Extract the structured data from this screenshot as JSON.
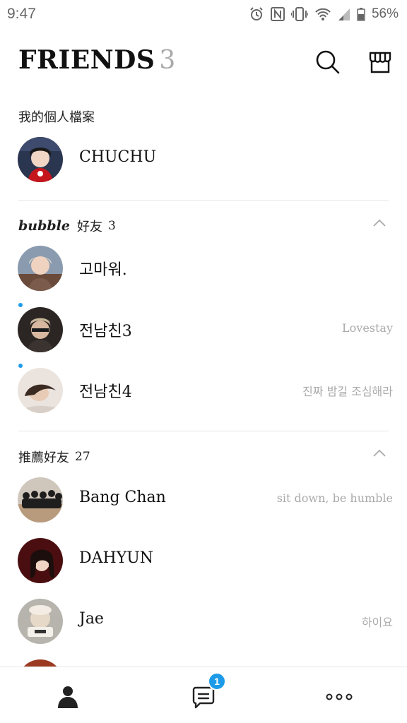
{
  "status_bar": {
    "time": "9:47",
    "battery": "56%",
    "icons": [
      "alarm-icon",
      "nfc-icon",
      "vibrate-icon",
      "wifi-icon",
      "signal-icon",
      "battery-icon"
    ]
  },
  "header": {
    "title": "FRIENDS",
    "count": "3",
    "search_icon": "search-icon",
    "shop_icon": "shop-icon"
  },
  "my_profile": {
    "label": "我的個人檔案",
    "name": "CHUCHU"
  },
  "bubble_section": {
    "bubble_word": "bubble",
    "label": "好友",
    "count": "3",
    "items": [
      {
        "name": "고마워.",
        "status": "",
        "new": false
      },
      {
        "name": "전남친3",
        "status": "Lovestay",
        "new": true
      },
      {
        "name": "전남친4",
        "status": "진짜 밤길 조심해라",
        "new": true
      }
    ]
  },
  "recommended_section": {
    "label": "推薦好友",
    "count": "27",
    "items": [
      {
        "name": "Bang Chan",
        "status": "sit down, be humble"
      },
      {
        "name": "DAHYUN",
        "status": ""
      },
      {
        "name": "Jae",
        "status": "하이요"
      }
    ]
  },
  "bottom_nav": {
    "items": [
      "person-icon",
      "chat-icon",
      "more-icon"
    ],
    "chat_badge": "1"
  },
  "colors": {
    "accent": "#1e9be8",
    "muted_text": "#aaaaaa",
    "divider": "#e6e6e6"
  }
}
